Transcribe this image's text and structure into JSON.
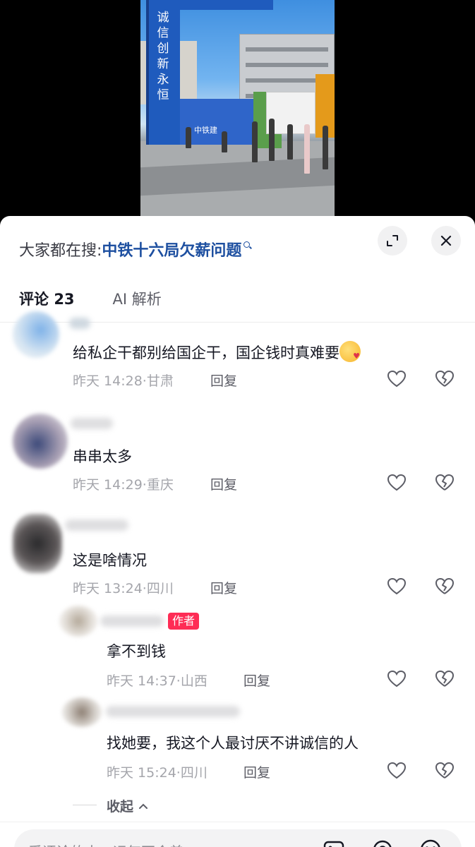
{
  "video": {
    "gate_text": "诚信创新永恒",
    "fence_logo_text": "中铁建"
  },
  "search": {
    "prefix": "大家都在搜:",
    "term": "中铁十六局欠薪问题"
  },
  "tabs": {
    "comments_label": "评论",
    "comments_count": "23",
    "ai_label": "AI 解析"
  },
  "comments": [
    {
      "text": "给私企干都别给国企干，国企钱时真难要",
      "emoji": "face-with-heart-icon",
      "time": "昨天 14:28",
      "location": "甘肃",
      "reply": "回复"
    },
    {
      "text": "串串太多",
      "time": "昨天 14:29",
      "location": "重庆",
      "reply": "回复"
    },
    {
      "text": "这是啥情况",
      "time": "昨天 13:24",
      "location": "四川",
      "reply": "回复"
    }
  ],
  "replies": [
    {
      "badge": "作者",
      "text": "拿不到钱",
      "time": "昨天 14:37",
      "location": "山西",
      "reply": "回复"
    },
    {
      "text": "找她要，我这个人最讨厌不讲诚信的人",
      "time": "昨天 15:24",
      "location": "四川",
      "reply": "回复"
    }
  ],
  "collapse_label": "收起",
  "input": {
    "placeholder": "爱评论的人，运气不会差"
  },
  "colors": {
    "accent": "#fe2c55",
    "link": "#1d4fa0",
    "meta": "#a4a5ab"
  }
}
